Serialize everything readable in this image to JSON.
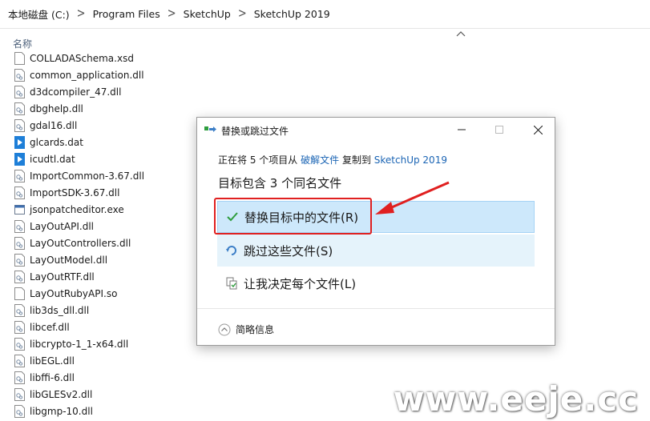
{
  "breadcrumb": [
    "本地磁盘 (C:)",
    "Program Files",
    "SketchUp",
    "SketchUp 2019"
  ],
  "breadcrumb_separator": ">",
  "column_header": "名称",
  "files": [
    {
      "name": "COLLADASchema.xsd",
      "icon": "document-icon"
    },
    {
      "name": "common_application.dll",
      "icon": "dll-icon"
    },
    {
      "name": "d3dcompiler_47.dll",
      "icon": "dll-icon"
    },
    {
      "name": "dbghelp.dll",
      "icon": "dll-icon"
    },
    {
      "name": "gdal16.dll",
      "icon": "dll-icon"
    },
    {
      "name": "glcards.dat",
      "icon": "dat-icon"
    },
    {
      "name": "icudtl.dat",
      "icon": "dat-icon"
    },
    {
      "name": "ImportCommon-3.67.dll",
      "icon": "dll-icon"
    },
    {
      "name": "ImportSDK-3.67.dll",
      "icon": "dll-icon"
    },
    {
      "name": "jsonpatcheditor.exe",
      "icon": "exe-icon"
    },
    {
      "name": "LayOutAPI.dll",
      "icon": "dll-icon"
    },
    {
      "name": "LayOutControllers.dll",
      "icon": "dll-icon"
    },
    {
      "name": "LayOutModel.dll",
      "icon": "dll-icon"
    },
    {
      "name": "LayOutRTF.dll",
      "icon": "dll-icon"
    },
    {
      "name": "LayOutRubyAPI.so",
      "icon": "document-icon"
    },
    {
      "name": "lib3ds_dll.dll",
      "icon": "dll-icon"
    },
    {
      "name": "libcef.dll",
      "icon": "dll-icon"
    },
    {
      "name": "libcrypto-1_1-x64.dll",
      "icon": "dll-icon"
    },
    {
      "name": "libEGL.dll",
      "icon": "dll-icon"
    },
    {
      "name": "libffi-6.dll",
      "icon": "dll-icon"
    },
    {
      "name": "libGLESv2.dll",
      "icon": "dll-icon"
    },
    {
      "name": "libgmp-10.dll",
      "icon": "dll-icon"
    }
  ],
  "dialog": {
    "title": "替换或跳过文件",
    "progress": {
      "prefix": "正在将 5 个项目从",
      "source": "破解文件",
      "middle": "复制到",
      "destination": "SketchUp 2019"
    },
    "conflict_text": "目标包含 3 个同名文件",
    "options": [
      {
        "label": "替换目标中的文件(R)",
        "icon": "checkmark-icon"
      },
      {
        "label": "跳过这些文件(S)",
        "icon": "skip-icon"
      },
      {
        "label": "让我决定每个文件(L)",
        "icon": "decide-icon"
      }
    ],
    "details_label": "简略信息"
  },
  "watermark": "www.eeje.cc",
  "colors": {
    "accent": "#1a64b4",
    "highlight": "#e02020",
    "option_selected": "#cde8fb",
    "option_hover": "#e5f3fb"
  }
}
